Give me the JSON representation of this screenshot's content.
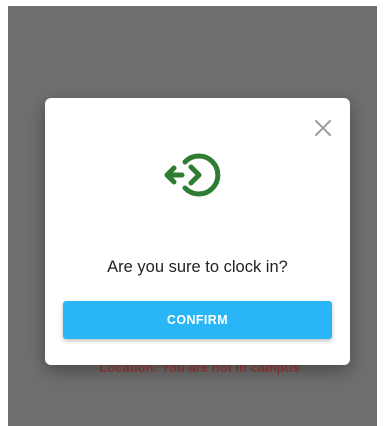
{
  "background": {
    "hint_text": "Location: You are not in campus"
  },
  "dialog": {
    "close_icon": "close-icon",
    "clock_icon": "clock-in-icon",
    "message": "Are you sure to clock in?",
    "confirm_label": "CONFIRM"
  },
  "colors": {
    "overlay": "#6f6f6f",
    "icon_green": "#2e7d32",
    "confirm_blue": "#29b6f6",
    "hint_red": "#a23a34"
  }
}
